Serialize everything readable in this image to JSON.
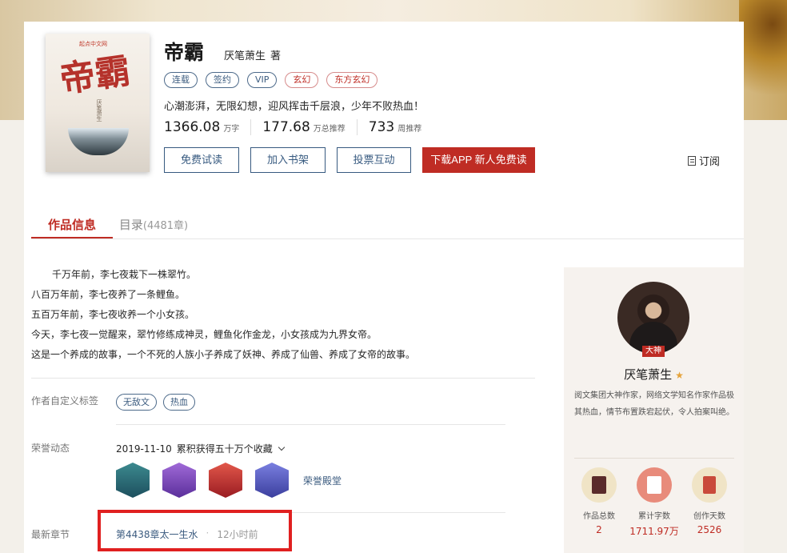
{
  "book": {
    "cover_brand": "起点中文网",
    "cover_big": "帝霸",
    "cover_author": "厌笔萧生",
    "title": "帝霸",
    "author": "厌笔萧生",
    "author_suffix": "著",
    "tags": [
      "连载",
      "签约",
      "VIP",
      "玄幻",
      "东方玄幻"
    ],
    "intro": "心潮澎湃，无限幻想，迎风挥击千层浪，少年不败热血！",
    "stats": [
      {
        "num": "1366.08",
        "unit": "万字"
      },
      {
        "num": "177.68",
        "unit": "万总推荐"
      },
      {
        "num": "733",
        "unit": "周推荐"
      }
    ],
    "actions": [
      "免费试读",
      "加入书架",
      "投票互动",
      "下载APP  新人免费读"
    ],
    "subscribe": "订阅"
  },
  "tabs": [
    {
      "label": "作品信息",
      "count": ""
    },
    {
      "label": "目录",
      "count": "(4481章)"
    }
  ],
  "synopsis": [
    "千万年前，李七夜栽下一株翠竹。",
    "八百万年前，李七夜养了一条鲤鱼。",
    "五百万年前，李七夜收养一个小女孩。",
    "今天，李七夜一觉醒来，翠竹修练成神灵，鲤鱼化作金龙，小女孩成为九界女帝。",
    "这是一个养成的故事，一个不死的人族小子养成了妖神、养成了仙兽、养成了女帝的故事。"
  ],
  "custom_tags": {
    "label": "作者自定义标签",
    "tags": [
      "无敌文",
      "热血"
    ]
  },
  "honor": {
    "label": "荣誉动态",
    "date": "2019-11-10",
    "text": "累积获得五十万个收藏",
    "badges": [
      "",
      "",
      "",
      ""
    ],
    "hall": "荣誉殿堂"
  },
  "latest": {
    "label": "最新章节",
    "chapter": "第4438章太一生水",
    "sep": "·",
    "time": "12小时前"
  },
  "author_card": {
    "badge": "大神",
    "name": "厌笔萧生",
    "desc": "阅文集团大神作家，网络文学知名作家作品极其热血，情节布置跌宕起伏，令人拍案叫绝。",
    "stats": [
      {
        "label": "作品总数",
        "value": "2"
      },
      {
        "label": "累计字数",
        "value": "1711.97万"
      },
      {
        "label": "创作天数",
        "value": "2526"
      }
    ]
  }
}
